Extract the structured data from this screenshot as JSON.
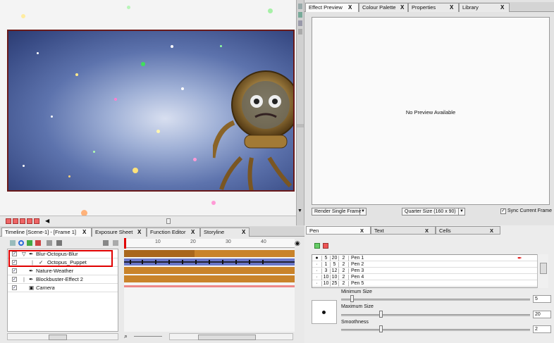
{
  "viewer": {
    "toolbar_icons": [
      "zoom-icon",
      "reset-icon",
      "camera-icon",
      "mask-icon",
      "grid-icon"
    ]
  },
  "effect_panel": {
    "tabs": [
      {
        "label": "Effect Preview",
        "active": true
      },
      {
        "label": "Colour Palette",
        "active": false
      },
      {
        "label": "Properties",
        "active": false
      },
      {
        "label": "Library",
        "active": false
      }
    ],
    "close_glyph": "X",
    "empty_message": "No Preview Available",
    "render_button": "Render Single Frame",
    "size_select": "Quarter Size (160 x 90)",
    "sync_label": "Sync Current Frame",
    "sync_checked": true
  },
  "timeline": {
    "tabs": [
      {
        "label": "Timeline [Scene-1] - [Frame 1]",
        "active": true
      },
      {
        "label": "Exposure Sheet",
        "active": false
      },
      {
        "label": "Function Editor",
        "active": false
      },
      {
        "label": "Storyline",
        "active": false
      }
    ],
    "ruler": [
      "10",
      "20",
      "30",
      "40"
    ],
    "layers": [
      {
        "name": "Blur-Octopus-Blur",
        "checked": true,
        "highlighted": true,
        "italic": false
      },
      {
        "name": "Octopus_Puppet",
        "checked": true,
        "highlighted": true,
        "italic": false
      },
      {
        "name": "Nature-Weather",
        "checked": true,
        "highlighted": false,
        "italic": false
      },
      {
        "name": "Blockbuster-Effect 2",
        "checked": true,
        "highlighted": false,
        "italic": false
      },
      {
        "name": "Camera",
        "checked": true,
        "highlighted": false,
        "italic": true
      }
    ]
  },
  "pen_panel": {
    "tabs": [
      {
        "label": "Pen",
        "active": true
      },
      {
        "label": "Text",
        "active": false
      },
      {
        "label": "Cells",
        "active": false
      }
    ],
    "presets": [
      {
        "mark": "●",
        "min": "5",
        "max": "20",
        "smooth": "2",
        "name": "Pen 1"
      },
      {
        "mark": "·",
        "min": "1",
        "max": "5",
        "smooth": "2",
        "name": "Pen 2"
      },
      {
        "mark": "·",
        "min": "3",
        "max": "12",
        "smooth": "2",
        "name": "Pen 3"
      },
      {
        "mark": "·",
        "min": "10",
        "max": "10",
        "smooth": "2",
        "name": "Pen 4"
      },
      {
        "mark": "·",
        "min": "10",
        "max": "25",
        "smooth": "2",
        "name": "Pen 5"
      }
    ],
    "min_size": {
      "label": "Minimum Size",
      "value": "5",
      "level": 0.05
    },
    "max_size": {
      "label": "Maximum Size",
      "value": "20",
      "level": 0.2
    },
    "smoothness": {
      "label": "Smoothness",
      "value": "2",
      "level": 0.2
    },
    "colors": {
      "accent": "#e00000",
      "track_brown": "#c9832a",
      "track_blue": "#6a76c8"
    }
  }
}
